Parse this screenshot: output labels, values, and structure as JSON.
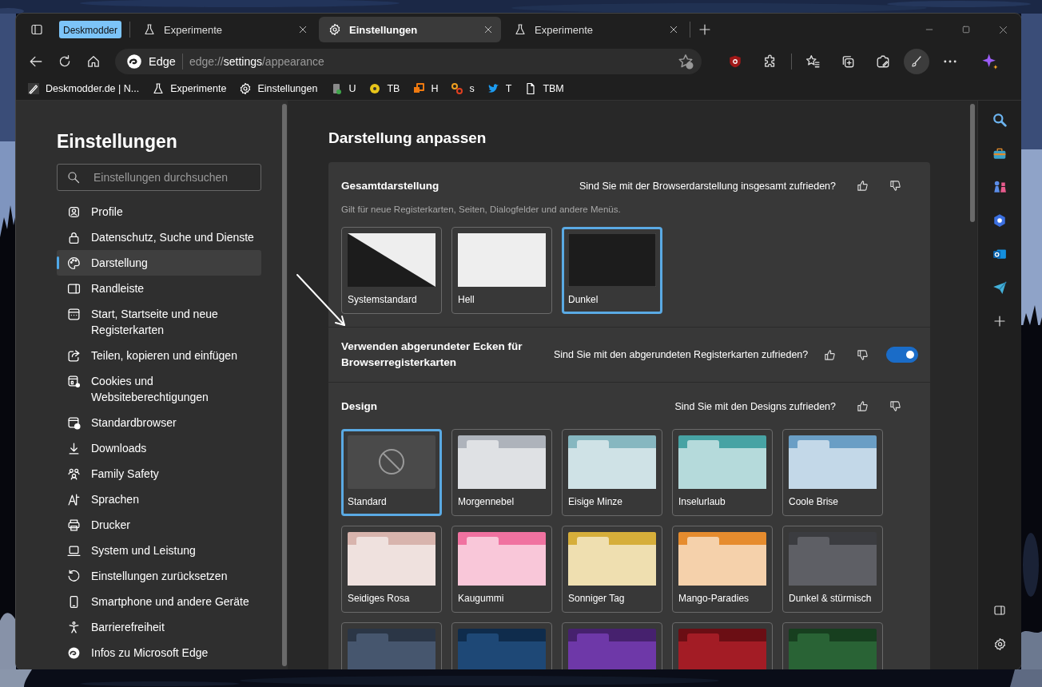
{
  "tab_group": {
    "label": "Deskmodder"
  },
  "tabs": [
    {
      "label": "Experimente",
      "selected": false
    },
    {
      "label": "Einstellungen",
      "selected": true
    },
    {
      "label": "Experimente",
      "selected": false
    }
  ],
  "address_bar": {
    "site_label": "Edge",
    "url": "edge://**settings**/appearance"
  },
  "favorites": [
    {
      "label": "Deskmodder.de | N..."
    },
    {
      "label": "Experimente"
    },
    {
      "label": "Einstellungen"
    },
    {
      "label": "U"
    },
    {
      "label": "TB"
    },
    {
      "label": "H"
    },
    {
      "label": "s"
    },
    {
      "label": "T"
    },
    {
      "label": "TBM"
    }
  ],
  "settings_nav": {
    "title": "Einstellungen",
    "search": {
      "placeholder": "Einstellungen durchsuchen"
    },
    "items": [
      {
        "label": "Profile",
        "selected": false
      },
      {
        "label": "Datenschutz, Suche und Dienste",
        "selected": false
      },
      {
        "label": "Darstellung",
        "selected": true
      },
      {
        "label": "Randleiste",
        "selected": false
      },
      {
        "label": "Start, Startseite und neue Registerkarten",
        "selected": false
      },
      {
        "label": "Teilen, kopieren und einfügen",
        "selected": false
      },
      {
        "label": "Cookies und Websiteberechtigungen",
        "selected": false
      },
      {
        "label": "Standardbrowser",
        "selected": false
      },
      {
        "label": "Downloads",
        "selected": false
      },
      {
        "label": "Family Safety",
        "selected": false
      },
      {
        "label": "Sprachen",
        "selected": false
      },
      {
        "label": "Drucker",
        "selected": false
      },
      {
        "label": "System und Leistung",
        "selected": false
      },
      {
        "label": "Einstellungen zurücksetzen",
        "selected": false
      },
      {
        "label": "Smartphone und andere Geräte",
        "selected": false
      },
      {
        "label": "Barrierefreiheit",
        "selected": false
      },
      {
        "label": "Infos zu Microsoft Edge",
        "selected": false
      }
    ]
  },
  "main": {
    "title": "Darstellung anpassen",
    "overall": {
      "title": "Gesamtdarstellung",
      "feedback": "Sind Sie mit der Browserdarstellung insgesamt zufrieden?",
      "hint": "Gilt für neue Registerkarten, Seiten, Dialogfelder und andere Menüs.",
      "options": [
        {
          "label": "Systemstandard",
          "kind": "system",
          "selected": false
        },
        {
          "label": "Hell",
          "kind": "light",
          "selected": false
        },
        {
          "label": "Dunkel",
          "kind": "dark",
          "selected": true
        }
      ]
    },
    "rounded_tabs": {
      "title": "Verwenden abgerundeter Ecken für Browserregisterkarten",
      "feedback": "Sind Sie mit den abgerundeten Registerkarten zufrieden?",
      "on": true
    },
    "design": {
      "title": "Design",
      "feedback": "Sind Sie mit den Designs zufrieden?",
      "themes": [
        {
          "label": "Standard",
          "kind": "none",
          "selected": true
        },
        {
          "label": "Morgennebel",
          "kind": "light",
          "color": "#aeb3bb",
          "selected": false
        },
        {
          "label": "Eisige Minze",
          "kind": "light",
          "color": "#86b7c0",
          "selected": false
        },
        {
          "label": "Inselurlaub",
          "kind": "light",
          "color": "#47a3a4",
          "selected": false
        },
        {
          "label": "Coole Brise",
          "kind": "light",
          "color": "#6a9ec5",
          "selected": false
        },
        {
          "label": "Seidiges Rosa",
          "kind": "light",
          "color": "#d8b4ad",
          "selected": false
        },
        {
          "label": "Kaugummi",
          "kind": "light",
          "color": "#f072a0",
          "selected": false
        },
        {
          "label": "Sonniger Tag",
          "kind": "light",
          "color": "#d6ae3a",
          "selected": false
        },
        {
          "label": "Mango-Paradies",
          "kind": "light",
          "color": "#e68c2e",
          "selected": false
        },
        {
          "label": "Dunkel & stürmisch",
          "kind": "dark",
          "color": "#3b3c40",
          "selected": false
        },
        {
          "kind": "dark",
          "color": "#2b3646",
          "selected": false
        },
        {
          "kind": "dark",
          "color": "#0f2c4c",
          "selected": false
        },
        {
          "kind": "dark",
          "color": "#46216e",
          "selected": false
        },
        {
          "kind": "dark",
          "color": "#6b0e14",
          "selected": false
        },
        {
          "kind": "dark",
          "color": "#173f1f",
          "selected": false
        }
      ]
    }
  }
}
